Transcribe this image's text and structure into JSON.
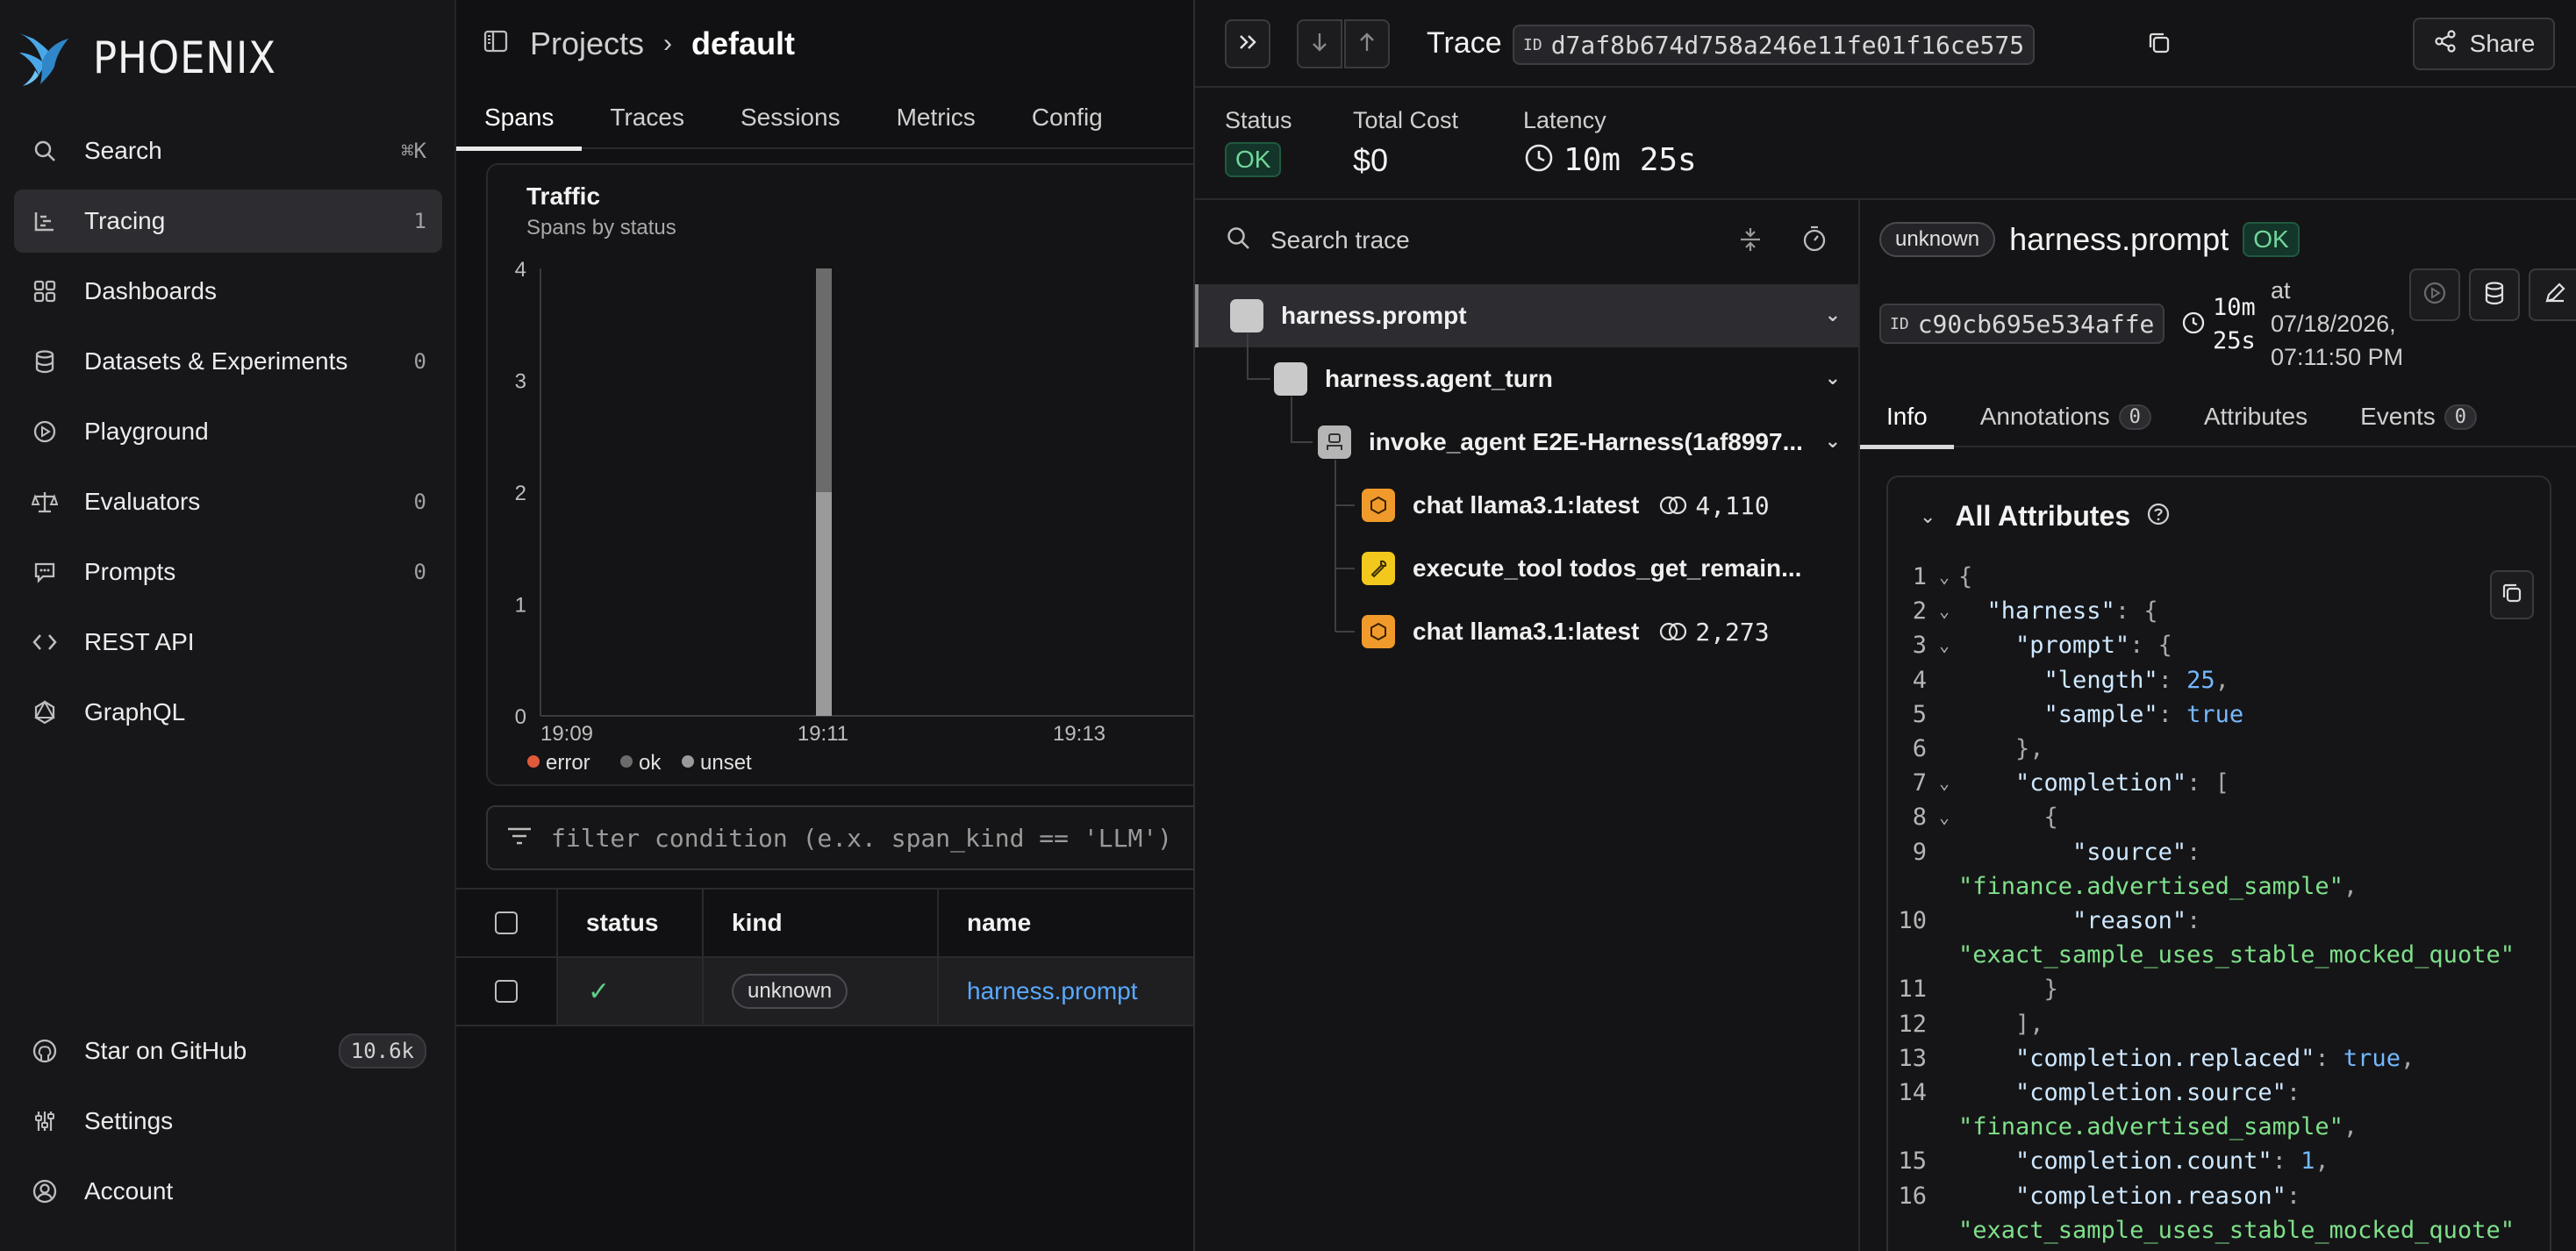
{
  "app": {
    "name": "PHOENIX"
  },
  "sidebar": {
    "items": [
      {
        "label": "Search",
        "trail": "⌘K",
        "icon": "search-icon"
      },
      {
        "label": "Tracing",
        "trail": "1",
        "icon": "tracing-icon",
        "active": true
      },
      {
        "label": "Dashboards",
        "trail": "",
        "icon": "dashboards-icon"
      },
      {
        "label": "Datasets & Experiments",
        "trail": "0",
        "icon": "database-icon"
      },
      {
        "label": "Playground",
        "trail": "",
        "icon": "playground-icon"
      },
      {
        "label": "Evaluators",
        "trail": "0",
        "icon": "scale-icon"
      },
      {
        "label": "Prompts",
        "trail": "0",
        "icon": "prompt-icon"
      },
      {
        "label": "REST API",
        "trail": "",
        "icon": "code-icon"
      },
      {
        "label": "GraphQL",
        "trail": "",
        "icon": "graphql-icon"
      }
    ],
    "bottom": [
      {
        "label": "Star on GitHub",
        "trail": "10.6k",
        "icon": "github-icon"
      },
      {
        "label": "Settings",
        "trail": "",
        "icon": "settings-icon"
      },
      {
        "label": "Account",
        "trail": "",
        "icon": "account-icon"
      }
    ]
  },
  "header": {
    "breadcrumb_projects": "Projects",
    "breadcrumb_current": "default"
  },
  "project_tabs": [
    "Spans",
    "Traces",
    "Sessions",
    "Metrics",
    "Config"
  ],
  "traffic": {
    "title": "Traffic",
    "subtitle": "Spans by status",
    "legend": [
      {
        "label": "error",
        "color": "#e05a3a"
      },
      {
        "label": "ok",
        "color": "#6b6b6b"
      },
      {
        "label": "unset",
        "color": "#9a9a9a"
      }
    ]
  },
  "chart_data": {
    "type": "bar",
    "stacked": true,
    "x_ticks": [
      "19:09",
      "19:11",
      "19:13"
    ],
    "y_ticks": [
      "0",
      "1",
      "2",
      "3",
      "4"
    ],
    "ylim": [
      0,
      4
    ],
    "bars": [
      {
        "x": "19:11",
        "unset": 2,
        "ok": 2,
        "error": 0
      }
    ],
    "grid": false,
    "legend_position": "bottom-left"
  },
  "filter": {
    "placeholder": "filter condition (e.x. span_kind == 'LLM')"
  },
  "spans_table": {
    "columns": [
      "status",
      "kind",
      "name"
    ],
    "rows": [
      {
        "status": "✓",
        "kind": "unknown",
        "name": "harness.prompt"
      }
    ]
  },
  "trace": {
    "title": "Trace",
    "id_label": "ID",
    "trace_id": "d7af8b674d758a246e11fe01f16ce575",
    "share_label": "Share",
    "status_label": "Status",
    "status_value": "OK",
    "cost_label": "Total Cost",
    "cost_value": "$0",
    "latency_label": "Latency",
    "latency_value": "10m 25s",
    "search_placeholder": "Search trace",
    "tree": [
      {
        "name": "harness.prompt",
        "kind": "unknown",
        "tokens": ""
      },
      {
        "name": "harness.agent_turn",
        "kind": "unknown",
        "tokens": ""
      },
      {
        "name": "invoke_agent E2E-Harness(1af8997...",
        "kind": "agent",
        "tokens": ""
      },
      {
        "name": "chat llama3.1:latest",
        "kind": "llm",
        "tokens": "4,110"
      },
      {
        "name": "execute_tool todos_get_remain...",
        "kind": "tool",
        "tokens": ""
      },
      {
        "name": "chat llama3.1:latest",
        "kind": "llm",
        "tokens": "2,273"
      }
    ]
  },
  "span": {
    "kind_badge": "unknown",
    "name": "harness.prompt",
    "status": "OK",
    "id_label": "ID",
    "span_id": "c90cb695e534affe",
    "latency_line1": "10m",
    "latency_line2": "25s",
    "time_line1": "at",
    "time_line2": "07/18/2026,",
    "time_line3": "07:11:50 PM",
    "tabs": [
      {
        "label": "Info",
        "count": ""
      },
      {
        "label": "Annotations",
        "count": "0"
      },
      {
        "label": "Attributes",
        "count": ""
      },
      {
        "label": "Events",
        "count": "0"
      }
    ],
    "attributes_title": "All Attributes",
    "json_lines": [
      {
        "no": "1",
        "fold": "⌄",
        "html": "<span class='p'>{</span>"
      },
      {
        "no": "2",
        "fold": "⌄",
        "html": "  <span class='k'>\"harness\"</span><span class='p'>: {</span>"
      },
      {
        "no": "3",
        "fold": "⌄",
        "html": "    <span class='k'>\"prompt\"</span><span class='p'>: {</span>"
      },
      {
        "no": "4",
        "fold": "",
        "html": "      <span class='k'>\"length\"</span><span class='p'>: </span><span class='n'>25</span><span class='p'>,</span>"
      },
      {
        "no": "5",
        "fold": "",
        "html": "      <span class='k'>\"sample\"</span><span class='p'>: </span><span class='b'>true</span>"
      },
      {
        "no": "6",
        "fold": "",
        "html": "    <span class='p'>},</span>"
      },
      {
        "no": "7",
        "fold": "⌄",
        "html": "    <span class='k'>\"completion\"</span><span class='p'>: [</span>"
      },
      {
        "no": "8",
        "fold": "⌄",
        "html": "      <span class='p'>{</span>"
      },
      {
        "no": "9",
        "fold": "",
        "html": "        <span class='k'>\"source\"</span><span class='p'>:</span>"
      },
      {
        "no": "",
        "fold": "",
        "html": "<span class='s'>\"finance.advertised_sample\"</span><span class='p'>,</span>"
      },
      {
        "no": "10",
        "fold": "",
        "html": "        <span class='k'>\"reason\"</span><span class='p'>:</span>"
      },
      {
        "no": "",
        "fold": "",
        "html": "<span class='s'>\"exact_sample_uses_stable_mocked_quote\"</span>"
      },
      {
        "no": "11",
        "fold": "",
        "html": "      <span class='p'>}</span>"
      },
      {
        "no": "12",
        "fold": "",
        "html": "    <span class='p'>],</span>"
      },
      {
        "no": "13",
        "fold": "",
        "html": "    <span class='k'>\"completion.replaced\"</span><span class='p'>: </span><span class='b'>true</span><span class='p'>,</span>"
      },
      {
        "no": "14",
        "fold": "",
        "html": "    <span class='k'>\"completion.source\"</span><span class='p'>:</span>"
      },
      {
        "no": "",
        "fold": "",
        "html": "<span class='s'>\"finance.advertised_sample\"</span><span class='p'>,</span>"
      },
      {
        "no": "15",
        "fold": "",
        "html": "    <span class='k'>\"completion.count\"</span><span class='p'>: </span><span class='n'>1</span><span class='p'>,</span>"
      },
      {
        "no": "16",
        "fold": "",
        "html": "    <span class='k'>\"completion.reason\"</span><span class='p'>:</span>"
      },
      {
        "no": "",
        "fold": "",
        "html": "<span class='s'>\"exact_sample_uses_stable_mocked_quote\"</span>"
      }
    ]
  }
}
